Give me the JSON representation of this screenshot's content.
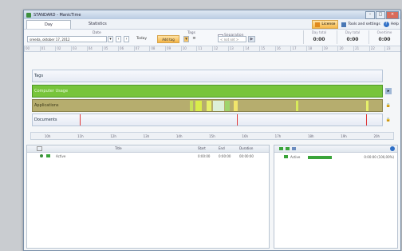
{
  "window": {
    "title": "STANDARD - ManicTime"
  },
  "tabs": [
    {
      "label": "Day"
    },
    {
      "label": "Statistics"
    }
  ],
  "menu": {
    "license": "License",
    "tools": "Tools and settings",
    "help": "Help"
  },
  "toolbar": {
    "date_label": "Date",
    "date_value": "sreeda, oktober 17, 2012",
    "today": "Today",
    "tags_label": "Tags",
    "add_tag": "Add tag",
    "sep_label": "Separation",
    "sep_value": "< not set >",
    "stats": [
      {
        "title": "Day total",
        "value": "0:00"
      },
      {
        "title": "Day total",
        "value": "0:00"
      },
      {
        "title": "Overtime",
        "value": "0:00"
      }
    ]
  },
  "timeline": {
    "hours": [
      "00",
      "01",
      "02",
      "03",
      "04",
      "05",
      "06",
      "07",
      "08",
      "09",
      "10",
      "11",
      "12",
      "13",
      "14",
      "15",
      "16",
      "17",
      "18",
      "19",
      "20",
      "21",
      "22",
      "23"
    ],
    "tracks": {
      "tags": "Tags",
      "computer_usage": "Computer Usage",
      "applications": "Applications",
      "documents": "Documents"
    },
    "tag_marker": "0:00",
    "scale": [
      "10h",
      "11h",
      "12h",
      "13h",
      "14h",
      "15h",
      "16h",
      "17h",
      "18h",
      "19h",
      "20h"
    ]
  },
  "grid": {
    "headers": {
      "title": "Title",
      "start": "Start",
      "end": "End",
      "duration": "Duration"
    },
    "rows": [
      {
        "title": "Active",
        "start": "0:00:00",
        "end": "0:00:00",
        "duration": "00:00:00"
      }
    ]
  },
  "detail": {
    "row_name": "Active",
    "row_value": "0:00:00 (100,00%)"
  },
  "colors": {
    "computer_usage": "#77c43b",
    "applications": "#b6ad6e",
    "accent": "#f4b343"
  }
}
